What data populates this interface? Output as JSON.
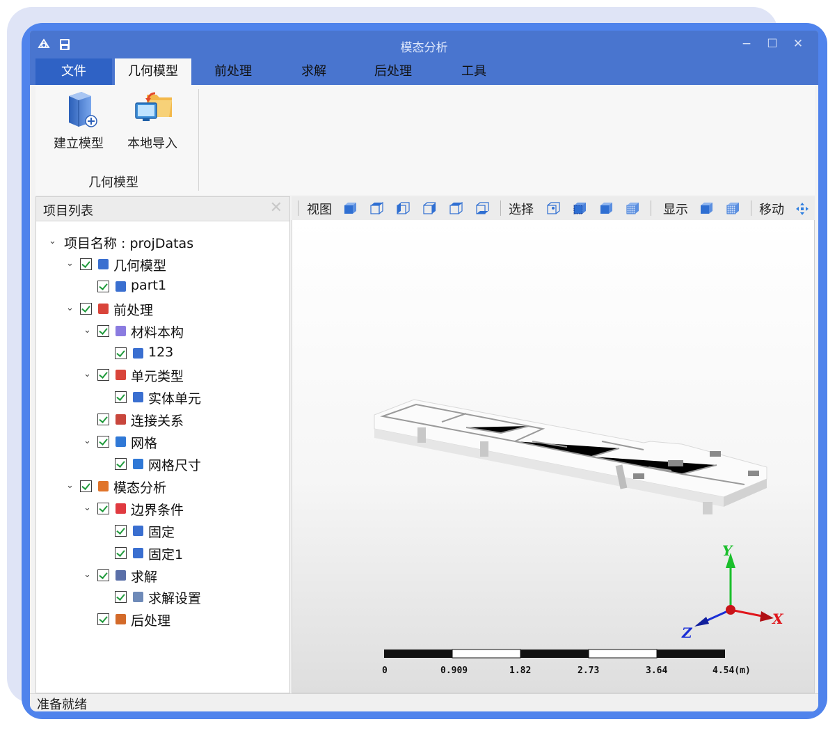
{
  "window": {
    "title": "模态分析"
  },
  "ribbon": {
    "file_tab": "文件",
    "tabs": [
      "几何模型",
      "前处理",
      "求解",
      "后处理",
      "工具"
    ],
    "buttons": [
      {
        "label": "建立模型",
        "icon": "build-model-icon"
      },
      {
        "label": "本地导入",
        "icon": "local-import-icon"
      }
    ],
    "group_label": "几何模型"
  },
  "panel": {
    "title": "项目列表",
    "close": "✕"
  },
  "tree": [
    {
      "label": "项目名称 : projDatas",
      "level": 0,
      "expandable": true,
      "checkbox": false,
      "icon": "none"
    },
    {
      "label": "几何模型",
      "level": 1,
      "expandable": true,
      "checkbox": true,
      "icon": "geometry-icon"
    },
    {
      "label": "part1",
      "level": 2,
      "expandable": false,
      "checkbox": true,
      "icon": "part-icon"
    },
    {
      "label": "前处理",
      "level": 1,
      "expandable": true,
      "checkbox": true,
      "icon": "preprocess-icon"
    },
    {
      "label": "材料本构",
      "level": 2,
      "expandable": true,
      "checkbox": true,
      "icon": "material-icon"
    },
    {
      "label": "123",
      "level": 3,
      "expandable": false,
      "checkbox": true,
      "icon": "grid-icon"
    },
    {
      "label": "单元类型",
      "level": 2,
      "expandable": true,
      "checkbox": true,
      "icon": "element-type-icon"
    },
    {
      "label": "实体单元",
      "level": 3,
      "expandable": false,
      "checkbox": true,
      "icon": "solid-element-icon"
    },
    {
      "label": "连接关系",
      "level": 2,
      "expandable": false,
      "checkbox": true,
      "icon": "connection-icon"
    },
    {
      "label": "网格",
      "level": 2,
      "expandable": true,
      "checkbox": true,
      "icon": "mesh-icon"
    },
    {
      "label": "网格尺寸",
      "level": 3,
      "expandable": false,
      "checkbox": true,
      "icon": "mesh-size-icon"
    },
    {
      "label": "模态分析",
      "level": 1,
      "expandable": true,
      "checkbox": true,
      "icon": "modal-analysis-icon"
    },
    {
      "label": "边界条件",
      "level": 2,
      "expandable": true,
      "checkbox": true,
      "icon": "boundary-icon"
    },
    {
      "label": "固定",
      "level": 3,
      "expandable": false,
      "checkbox": true,
      "icon": "fixed-icon"
    },
    {
      "label": "固定1",
      "level": 3,
      "expandable": false,
      "checkbox": true,
      "icon": "fixed-icon"
    },
    {
      "label": "求解",
      "level": 2,
      "expandable": true,
      "checkbox": true,
      "icon": "solve-icon"
    },
    {
      "label": "求解设置",
      "level": 3,
      "expandable": false,
      "checkbox": true,
      "icon": "solve-settings-icon"
    },
    {
      "label": "后处理",
      "level": 2,
      "expandable": false,
      "checkbox": true,
      "icon": "postprocess-icon"
    }
  ],
  "toolbar": {
    "view_label": "视图",
    "select_label": "选择",
    "display_label": "显示",
    "move_label": "移动"
  },
  "viewport": {
    "axes": {
      "x": "X",
      "y": "Y",
      "z": "Z"
    },
    "scale_labels": [
      "0",
      "0.909",
      "1.82",
      "2.73",
      "3.64",
      "4.54(m)"
    ]
  },
  "status": {
    "text": "准备就绪"
  },
  "colors": {
    "title_bar": "#4975cf",
    "file_tab": "#2f62c5",
    "frame": "#4f83ec",
    "axis_x": "#e0161c",
    "axis_y": "#1bbf2c",
    "axis_z": "#1a2fd6"
  }
}
